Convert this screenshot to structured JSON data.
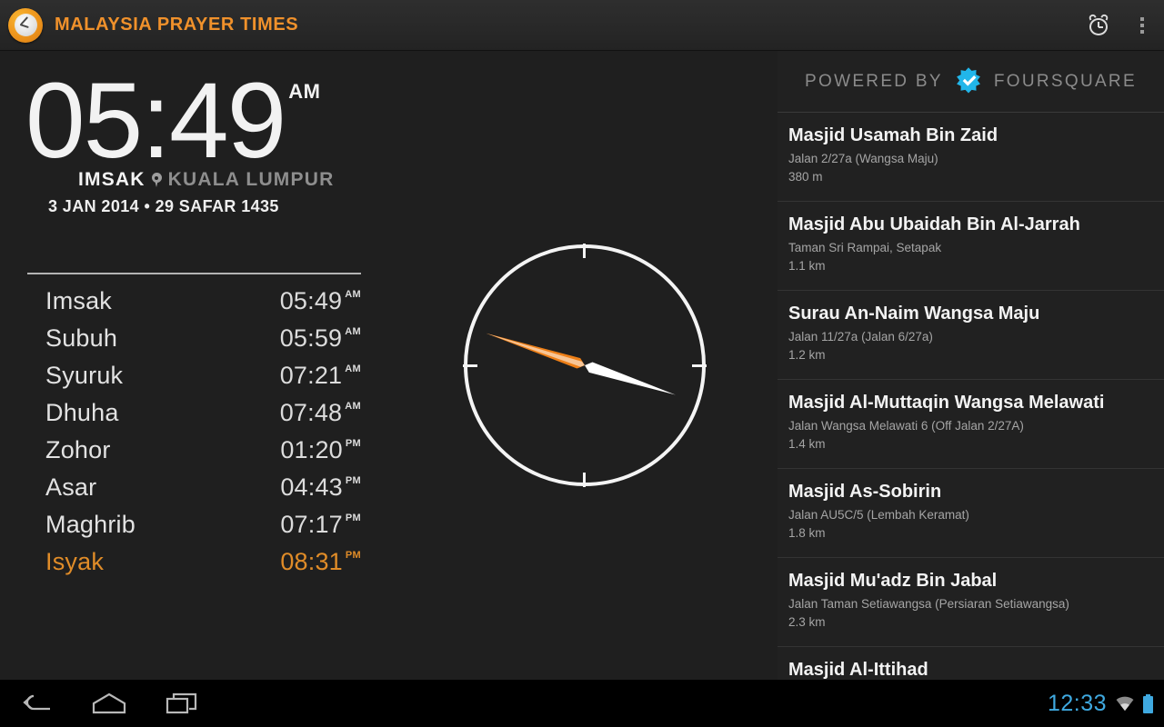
{
  "actionbar": {
    "app_icon": "clock-icon",
    "title": "MALAYSIA PRAYER TIMES",
    "alarm_label": "alarm-icon",
    "overflow_label": "overflow-menu-icon",
    "accent_color": "#f0912b"
  },
  "clock": {
    "time": "05:49",
    "meridiem": "AM",
    "prayer_label": "IMSAK",
    "location": "KUALA LUMPUR",
    "date": "3 JAN 2014 • 29 SAFAR 1435"
  },
  "prayers": [
    {
      "name": "Imsak",
      "time": "05:49",
      "meridiem": "AM",
      "active": false
    },
    {
      "name": "Subuh",
      "time": "05:59",
      "meridiem": "AM",
      "active": false
    },
    {
      "name": "Syuruk",
      "time": "07:21",
      "meridiem": "AM",
      "active": false
    },
    {
      "name": "Dhuha",
      "time": "07:48",
      "meridiem": "AM",
      "active": false
    },
    {
      "name": "Zohor",
      "time": "01:20",
      "meridiem": "PM",
      "active": false
    },
    {
      "name": "Asar",
      "time": "04:43",
      "meridiem": "PM",
      "active": false
    },
    {
      "name": "Maghrib",
      "time": "07:17",
      "meridiem": "PM",
      "active": false
    },
    {
      "name": "Isyak",
      "time": "08:31",
      "meridiem": "PM",
      "active": true
    }
  ],
  "compass": {
    "name": "qibla-compass",
    "needle_angle_deg": 108,
    "needle_front_color": "#ee7f17",
    "needle_back_color": "#ffffff",
    "ring_color": "#f4f4f4"
  },
  "venues_header": {
    "powered_by": "POWERED BY",
    "brand": "FOURSQUARE",
    "logo": "foursquare-icon",
    "logo_color": "#21b6ea"
  },
  "venues": [
    {
      "name": "Masjid Usamah Bin Zaid",
      "address": "Jalan 2/27a (Wangsa Maju)",
      "distance": "380 m"
    },
    {
      "name": "Masjid Abu Ubaidah Bin Al-Jarrah",
      "address": "Taman Sri Rampai, Setapak",
      "distance": "1.1 km"
    },
    {
      "name": "Surau An-Naim Wangsa Maju",
      "address": "Jalan 11/27a (Jalan 6/27a)",
      "distance": "1.2 km"
    },
    {
      "name": "Masjid Al-Muttaqin Wangsa Melawati",
      "address": "Jalan Wangsa Melawati 6 (Off Jalan 2/27A)",
      "distance": "1.4 km"
    },
    {
      "name": "Masjid As-Sobirin",
      "address": "Jalan AU5C/5 (Lembah Keramat)",
      "distance": "1.8 km"
    },
    {
      "name": "Masjid Mu'adz Bin Jabal",
      "address": "Jalan Taman Setiawangsa (Persiaran Setiawangsa)",
      "distance": "2.3 km"
    }
  ],
  "venue_partial": {
    "name": "Masjid Al-Ittihad"
  },
  "navbar": {
    "back": "back-icon",
    "home": "home-icon",
    "recents": "recent-apps-icon",
    "clock": "12:33",
    "wifi": "wifi-icon",
    "battery": "battery-icon",
    "status_color": "#3fa9e0"
  }
}
